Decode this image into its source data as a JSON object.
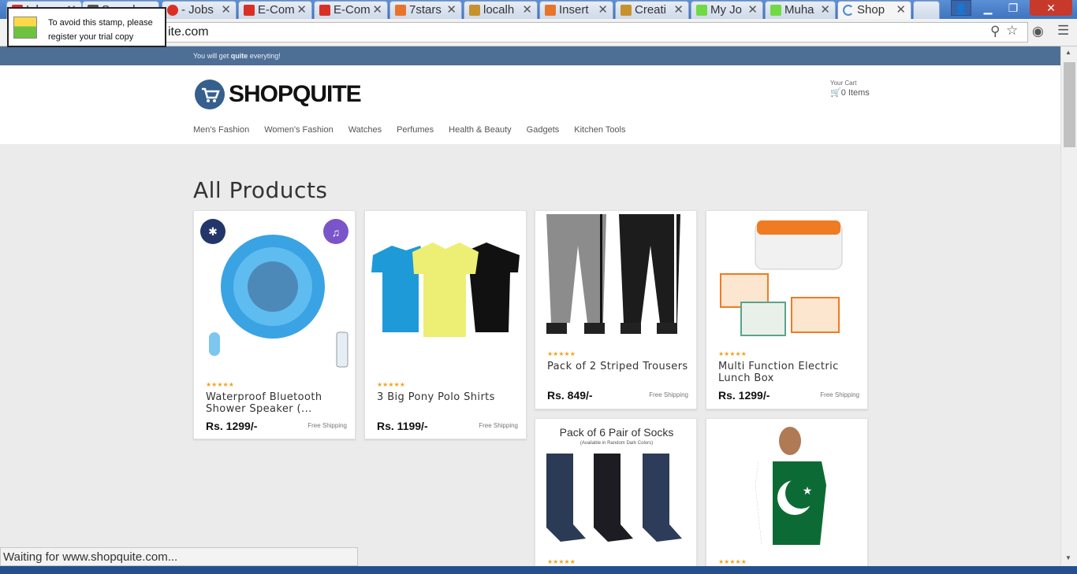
{
  "browser": {
    "tabs": [
      {
        "label": "Inbox",
        "color": "#d93025"
      },
      {
        "label": "Search",
        "color": "#555555"
      },
      {
        "label": "- Jobs",
        "color": "#d93025"
      },
      {
        "label": "E-Com",
        "color": "#d93025"
      },
      {
        "label": "E-Com",
        "color": "#d93025"
      },
      {
        "label": "7stars",
        "color": "#e8732a"
      },
      {
        "label": "localh",
        "color": "#c6922c"
      },
      {
        "label": "Insert",
        "color": "#e8732a"
      },
      {
        "label": "Creati",
        "color": "#c6922c"
      },
      {
        "label": "My Jo",
        "color": "#6fda44"
      },
      {
        "label": "Muha",
        "color": "#6fda44"
      },
      {
        "label": "Shop",
        "color": "#4a8ad6"
      }
    ],
    "url": "ite.com",
    "status": "Waiting for www.shopquite.com..."
  },
  "stamp": {
    "line1": "To avoid this stamp, please",
    "line2": "register your trial copy"
  },
  "site": {
    "tagline_pre": "You will get ",
    "tagline_bold": "quite",
    "tagline_post": " everyting!",
    "logo": "SHOPQUITE",
    "cart_label": "Your Cart",
    "cart_count": "0 Items",
    "nav": [
      "Men's Fashion",
      "Women's Fashion",
      "Watches",
      "Perfumes",
      "Health & Beauty",
      "Gadgets",
      "Kitchen Tools"
    ],
    "section_title": "All Products"
  },
  "products": [
    {
      "name": "Waterproof Bluetooth Shower Speaker (...",
      "price": "Rs. 1299/-",
      "shipping": "Free Shipping",
      "rating_text": "★★★★★",
      "image": "blue-speaker"
    },
    {
      "name": "3 Big Pony Polo Shirts",
      "price": "Rs. 1199/-",
      "shipping": "Free Shipping",
      "rating_text": "★★★★★",
      "image": "polo-shirts"
    },
    {
      "name": "Pack of 2 Striped Trousers",
      "price": "Rs. 849/-",
      "shipping": "Free Shipping",
      "rating_text": "★★★★★",
      "image": "trousers"
    },
    {
      "name": "Multi Function Electric Lunch Box",
      "price": "Rs. 1299/-",
      "shipping": "Free Shipping",
      "rating_text": "★★★★★",
      "image": "lunch-box"
    },
    {
      "name": "",
      "price": "",
      "shipping": "",
      "rating_text": "★★★★★",
      "image": "socks",
      "image_caption": "Pack of 6 Pair of Socks",
      "image_subcaption": "(Available in Random Dark Colors)"
    },
    {
      "name": "",
      "price": "",
      "shipping": "",
      "rating_text": "★★★★★",
      "image": "pakistan-tshirt"
    }
  ]
}
